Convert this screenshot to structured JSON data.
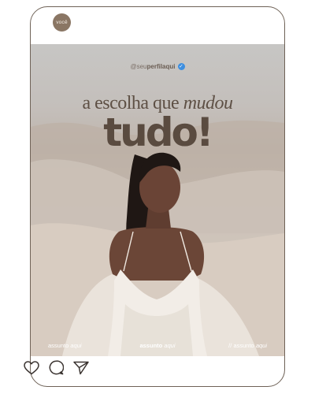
{
  "profile": {
    "avatar_label": "você"
  },
  "post": {
    "handle_prefix": "@seu",
    "handle_bold": "perfilaqui",
    "verified_icon": "✓",
    "headline_regular": "a escolha que",
    "headline_italic": "mudou",
    "headline_big": "tudo!",
    "tags": [
      {
        "word": "assunto",
        "italic": "aqui"
      },
      {
        "word": "assunto",
        "italic": "aqui"
      },
      {
        "prefix": "//",
        "word": "assunto",
        "italic": "aqui"
      }
    ]
  },
  "actions": {
    "like_icon": "heart-icon",
    "comment_icon": "comment-icon",
    "share_icon": "send-icon"
  },
  "colors": {
    "frame_border": "#6f6257",
    "avatar_bg": "#8a7664",
    "headline": "#5e5045",
    "verified": "#3d8fe0"
  }
}
